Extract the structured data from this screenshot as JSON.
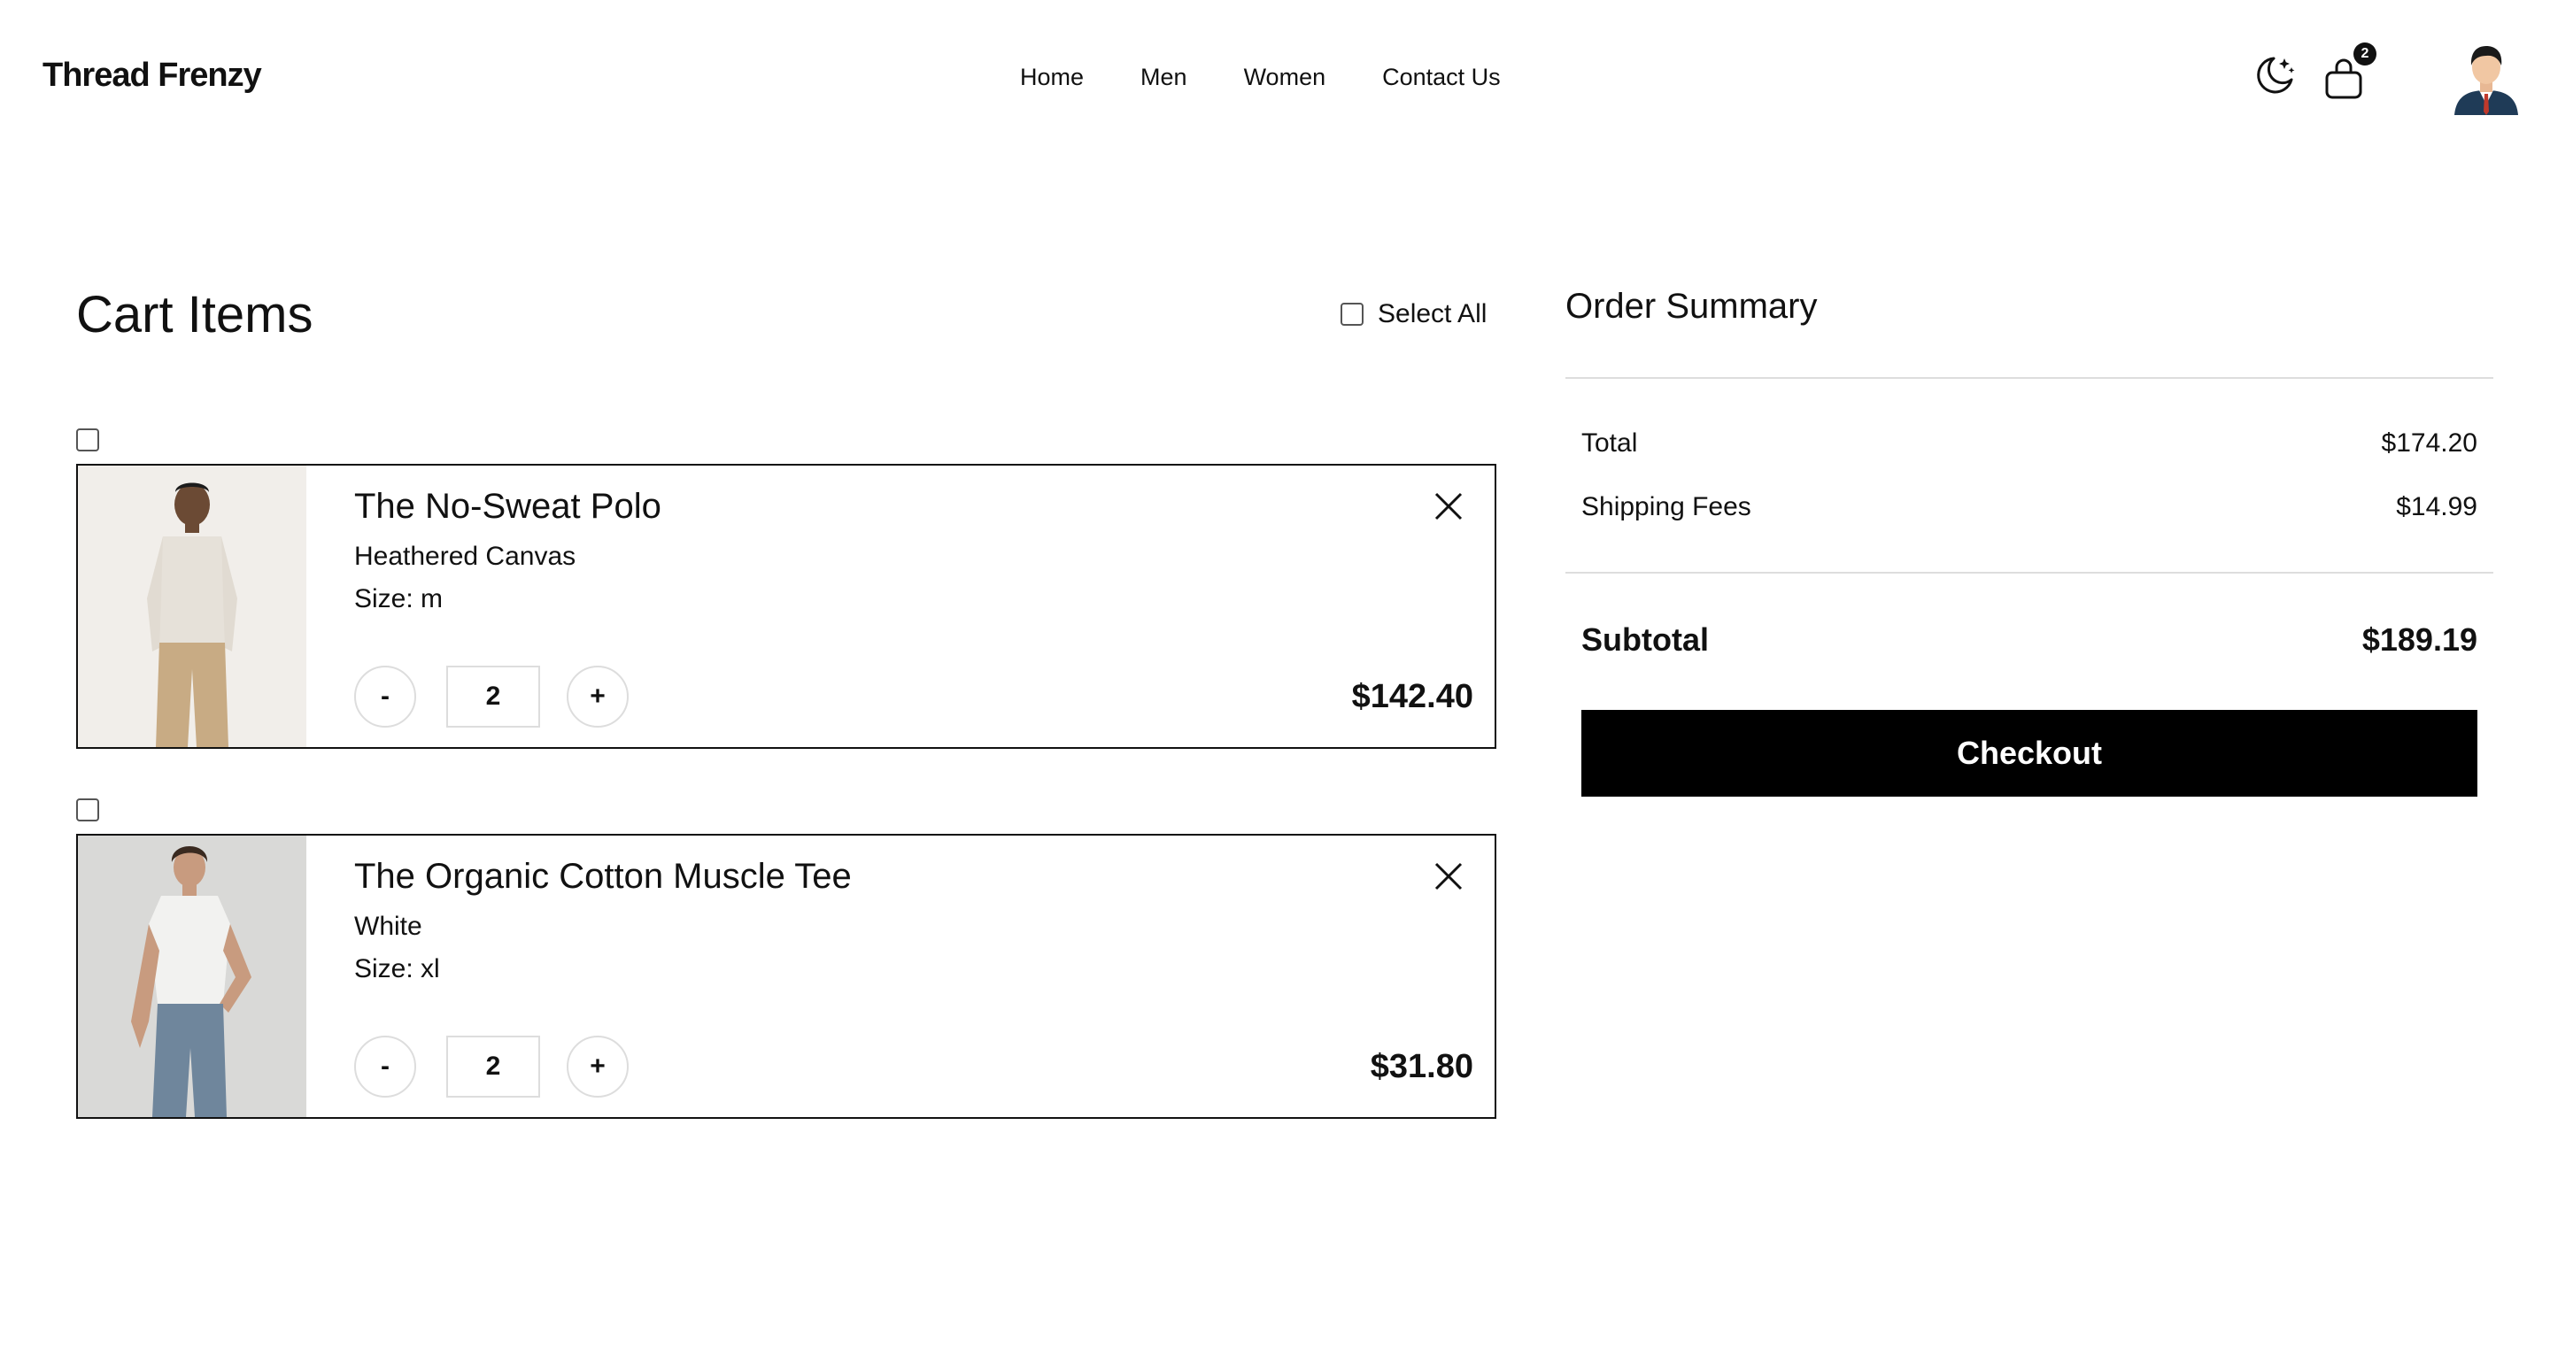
{
  "header": {
    "brand": "Thread Frenzy",
    "nav": [
      "Home",
      "Men",
      "Women",
      "Contact Us"
    ],
    "cart_count": "2",
    "icons": {
      "theme": "moon-icon",
      "cart": "shopping-bag-icon",
      "avatar": "user-avatar"
    }
  },
  "cart": {
    "title": "Cart Items",
    "select_all": "Select All",
    "items": [
      {
        "name": "The No-Sweat Polo",
        "color": "Heathered Canvas",
        "size": "Size: m",
        "qty": "2",
        "price": "$142.40",
        "minus": "-",
        "plus": "+"
      },
      {
        "name": "The Organic Cotton Muscle Tee",
        "color": "White",
        "size": "Size: xl",
        "qty": "2",
        "price": "$31.80",
        "minus": "-",
        "plus": "+"
      }
    ]
  },
  "summary": {
    "title": "Order Summary",
    "total_label": "Total",
    "total_value": "$174.20",
    "shipping_label": "Shipping Fees",
    "shipping_value": "$14.99",
    "subtotal_label": "Subtotal",
    "subtotal_value": "$189.19",
    "checkout": "Checkout"
  },
  "colors": {
    "accent": "#000000",
    "border": "#111111",
    "divider": "#dddddd"
  }
}
